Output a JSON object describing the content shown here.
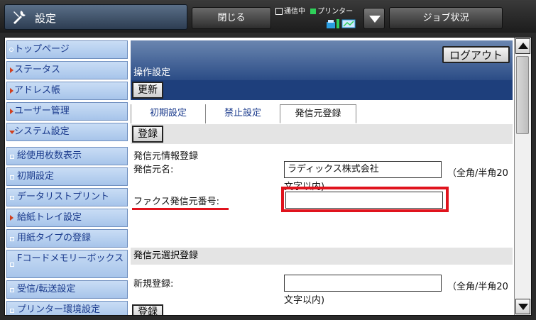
{
  "topbar": {
    "title": "設定",
    "close_label": "閉じる",
    "status_comm": "通信中",
    "status_printer": "プリンター",
    "job_status_label": "ジョブ状況"
  },
  "sidebar": {
    "items": [
      {
        "label": "トップページ",
        "marker": "circle"
      },
      {
        "label": "ステータス",
        "marker": "arrow"
      },
      {
        "label": "アドレス帳",
        "marker": "arrow"
      },
      {
        "label": "ユーザー管理",
        "marker": "arrow"
      },
      {
        "label": "システム設定",
        "marker": "arrow-down"
      },
      {
        "label": "総使用枚数表示",
        "marker": "square"
      },
      {
        "label": "初期設定",
        "marker": "square"
      },
      {
        "label": "データリストプリント",
        "marker": "square"
      },
      {
        "label": "給紙トレイ設定",
        "marker": "arrow"
      },
      {
        "label": "用紙タイプの登録",
        "marker": "square"
      },
      {
        "label": "Fコードメモリーボックス",
        "marker": "square"
      },
      {
        "label": "受信/転送設定",
        "marker": "square"
      },
      {
        "label": "プリンター環境設定",
        "marker": "square"
      }
    ]
  },
  "main": {
    "logout_label": "ログアウト",
    "section_title": "操作設定",
    "update_label": "更新",
    "tabs": [
      {
        "label": "初期設定",
        "active": false
      },
      {
        "label": "禁止設定",
        "active": false
      },
      {
        "label": "発信元登録",
        "active": true
      }
    ],
    "register_label": "登録",
    "sender_info_heading": "発信元情報登録",
    "sender_name_label": "発信元名:",
    "sender_name_value": "ラディックス株式会社",
    "sender_name_note": "（全角/半角20文字以内)",
    "fax_number_label": "ファクス発信元番号:",
    "fax_number_value": "",
    "select_section_title": "発信元選択登録",
    "new_reg_label": "新規登録:",
    "new_reg_value": "",
    "new_reg_note": "（全角/半角20文字以内)",
    "register_label_2": "登録"
  },
  "colors": {
    "highlight": "#e0131d",
    "header_blue": "#2b4c86",
    "sidebar_blue": "#a7c4ea"
  }
}
